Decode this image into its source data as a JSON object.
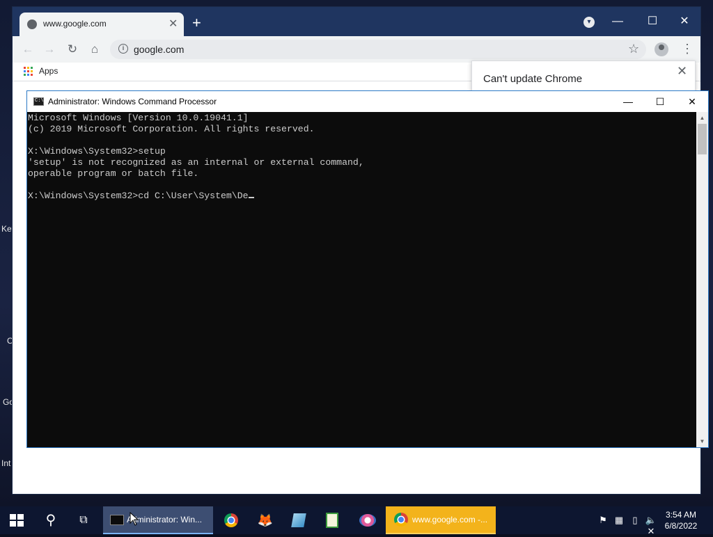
{
  "desktop": {
    "labels": [
      "Key",
      "C",
      "Go",
      "Int"
    ]
  },
  "chrome": {
    "tab_title": "www.google.com",
    "tab_close": "✕",
    "new_tab": "+",
    "minimize": "—",
    "maximize": "☐",
    "close": "✕",
    "back": "←",
    "forward": "→",
    "reload": "↻",
    "home": "⌂",
    "url": "google.com",
    "bookmark_star": "☆",
    "menu": "⋮",
    "apps_label": "Apps",
    "apps_colors": [
      "#ea4335",
      "#fbbc05",
      "#34a853",
      "#4285f4",
      "#ea4335",
      "#fbbc05",
      "#34a853",
      "#4285f4",
      "#ea4335"
    ],
    "popup_title": "Can't update Chrome",
    "popup_close": "✕"
  },
  "cmd": {
    "title": "Administrator: Windows Command Processor",
    "icon_text": "C:\\",
    "minimize": "—",
    "maximize": "☐",
    "close": "✕",
    "lines": [
      "Microsoft Windows [Version 10.0.19041.1]",
      "(c) 2019 Microsoft Corporation. All rights reserved.",
      "",
      "X:\\Windows\\System32>setup",
      "'setup' is not recognized as an internal or external command,",
      "operable program or batch file.",
      "",
      "X:\\Windows\\System32>cd C:\\User\\System\\De"
    ],
    "scroll_up": "▲",
    "scroll_down": "▼"
  },
  "taskbar": {
    "search_icon": "⚲",
    "taskview_icon": "⧉",
    "cmd_label": "Administrator: Win...",
    "chrome_label": "www.google.com -...",
    "firefox_icon": "🦊",
    "tray": [
      "⚑",
      "▦",
      "▯",
      "🔈✕"
    ],
    "time": "3:54 AM",
    "date": "6/8/2022"
  },
  "colors": {
    "chrome_titlebar": "#1f3560",
    "cmd_background": "#0c0c0c",
    "taskbar": "#0d1630",
    "taskbar_chrome_active": "#f3b31b"
  }
}
